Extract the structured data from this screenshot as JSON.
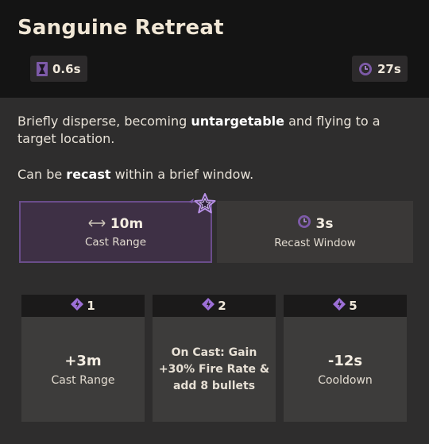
{
  "ability": {
    "title": "Sanguine Retreat",
    "cast_time": "0.6s",
    "cooldown": "27s"
  },
  "description": {
    "pre": "Briefly disperse, becoming ",
    "bold1": "untargetable",
    "post": " and flying to a target location.",
    "recast_pre": "Can be ",
    "recast_bold": "recast",
    "recast_post": " within a brief window."
  },
  "stats": {
    "range_value": "10m",
    "range_label": "Cast Range",
    "window_value": "3s",
    "window_label": "Recast Window"
  },
  "upgrades": [
    {
      "cost": "1",
      "value": "+3m",
      "label": "Cast Range"
    },
    {
      "cost": "2",
      "text_lines": [
        "On Cast: Gain",
        "+30% Fire Rate &",
        "add 8 bullets"
      ]
    },
    {
      "cost": "5",
      "value": "-12s",
      "label": "Cooldown"
    }
  ],
  "colors": {
    "accent_purple": "#9c6fd6",
    "highlight_border": "#6a4d8a"
  },
  "icons": {
    "cast_time": "hourglass-icon",
    "cooldown": "cooldown-clock-icon",
    "range": "range-arrows-icon",
    "recast_window": "cooldown-clock-icon",
    "upgrade_cost": "ability-point-icon",
    "imbue": "star-imbue-icon"
  }
}
